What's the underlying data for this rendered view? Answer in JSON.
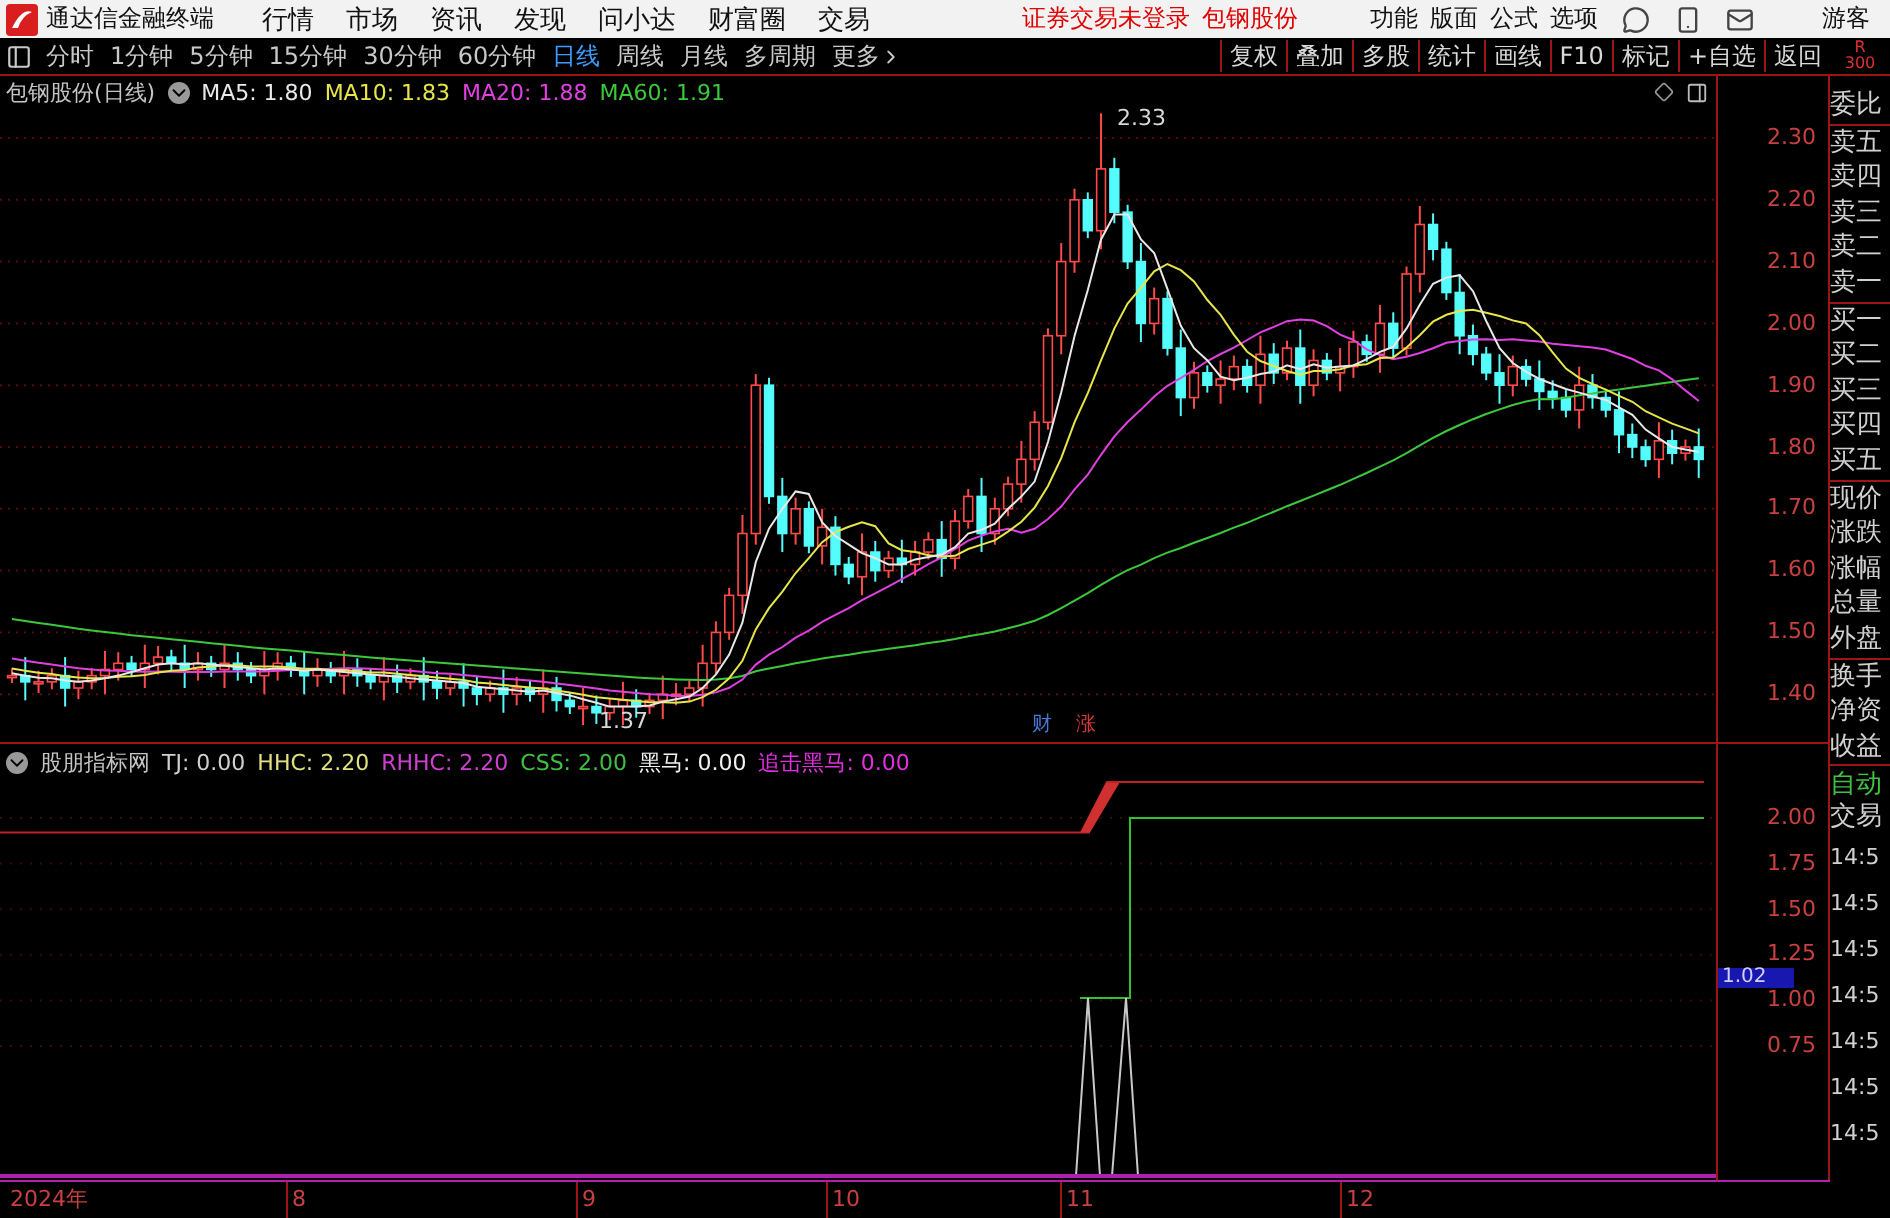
{
  "title_bar": {
    "app_name": "通达信金融终端",
    "menu": [
      "行情",
      "市场",
      "资讯",
      "发现",
      "问小达",
      "财富圈",
      "交易"
    ],
    "notice": "证券交易未登录",
    "stock": "包钢股份",
    "tools": [
      "功能",
      "版面",
      "公式",
      "选项"
    ],
    "user": "游客"
  },
  "toolbar": {
    "periods": [
      {
        "label": "分时",
        "selected": false
      },
      {
        "label": "1分钟",
        "selected": false
      },
      {
        "label": "5分钟",
        "selected": false
      },
      {
        "label": "15分钟",
        "selected": false
      },
      {
        "label": "30分钟",
        "selected": false
      },
      {
        "label": "60分钟",
        "selected": false
      },
      {
        "label": "日线",
        "selected": true
      },
      {
        "label": "周线",
        "selected": false
      },
      {
        "label": "月线",
        "selected": false
      },
      {
        "label": "多周期",
        "selected": false
      },
      {
        "label": "更多",
        "selected": false
      }
    ],
    "buttons": [
      "复权",
      "叠加",
      "多股",
      "统计",
      "画线",
      "F10",
      "标记",
      "+自选",
      "返回"
    ],
    "corner": [
      "R",
      "300"
    ]
  },
  "main_chart": {
    "legend": {
      "title": "包钢股份(日线)",
      "items": [
        {
          "label": "MA5: 1.80",
          "color": "#e8e8e8"
        },
        {
          "label": "MA10: 1.83",
          "color": "#e6e64a"
        },
        {
          "label": "MA20: 1.88",
          "color": "#e040e0"
        },
        {
          "label": "MA60: 1.91",
          "color": "#3cc83c"
        }
      ]
    },
    "high_label": "2.33",
    "low_label": "1.37",
    "markers": [
      {
        "label": "财",
        "color": "#4a78d8"
      },
      {
        "label": "涨",
        "color": "#d03838"
      }
    ],
    "price_axis": [
      "2.30",
      "2.20",
      "2.10",
      "2.00",
      "1.90",
      "1.80",
      "1.70",
      "1.60",
      "1.50",
      "1.40"
    ]
  },
  "indicator": {
    "legend": {
      "title": "股朋指标网",
      "items": [
        {
          "label": "TJ: 0.00",
          "color": "#d0d0d0"
        },
        {
          "label": "HHC: 2.20",
          "color": "#e0e080"
        },
        {
          "label": "RHHC: 2.20",
          "color": "#d040d0"
        },
        {
          "label": "CSS: 2.00",
          "color": "#40c040"
        },
        {
          "label": "黑马: 0.00",
          "color": "#f0f0f0"
        },
        {
          "label": "追击黑马: 0.00",
          "color": "#e030e0"
        }
      ]
    },
    "axis": [
      "2.00",
      "1.75",
      "1.50",
      "1.25",
      "1.00",
      "0.75"
    ],
    "cursor_value": "1.02"
  },
  "time_axis": [
    "2024年",
    "8",
    "9",
    "10",
    "11",
    "12"
  ],
  "right_panel": {
    "groups": [
      [
        "委比"
      ],
      [
        "卖五",
        "卖四",
        "卖三",
        "卖二",
        "卖一"
      ],
      [
        "买一",
        "买二",
        "买三",
        "买四",
        "买五"
      ],
      [
        "现价",
        "涨跌",
        "涨幅",
        "总量",
        "外盘"
      ],
      [
        "换手",
        "净资",
        "收益"
      ]
    ],
    "mode": "自动",
    "trade": "交易",
    "times": [
      "14:5",
      "14:5",
      "14:5",
      "14:5",
      "14:5",
      "14:5",
      "14:5"
    ]
  }
}
